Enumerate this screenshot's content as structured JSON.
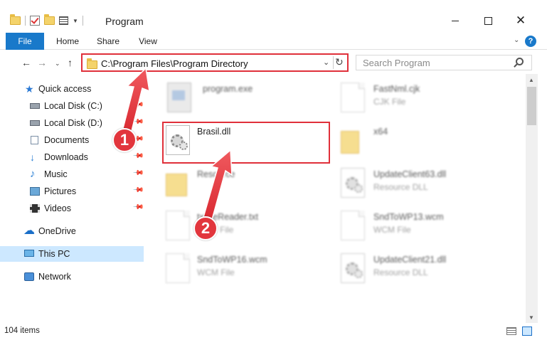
{
  "window": {
    "title": "Program",
    "minimize_icon": "minimize-icon",
    "maximize_icon": "maximize-icon",
    "close_glyph": "✕"
  },
  "ribbon": {
    "tabs": [
      "File",
      "Home",
      "Share",
      "View"
    ],
    "expand_glyph": "⌄",
    "help_glyph": "?"
  },
  "nav": {
    "back_glyph": "←",
    "forward_glyph": "→",
    "recent_glyph": "⌄",
    "up_glyph": "↑",
    "address": "C:\\Program Files\\Program Directory",
    "address_drop_glyph": "⌄",
    "refresh_glyph": "↻",
    "search_placeholder": "Search Program"
  },
  "sidebar": {
    "items": [
      {
        "label": "Quick access",
        "icon": "star-icon"
      },
      {
        "label": "Local Disk (C:)",
        "icon": "disk-icon"
      },
      {
        "label": "Local Disk (D:)",
        "icon": "disk-icon"
      },
      {
        "label": "Documents",
        "icon": "documents-icon"
      },
      {
        "label": "Downloads",
        "icon": "download-icon"
      },
      {
        "label": "Music",
        "icon": "music-icon"
      },
      {
        "label": "Pictures",
        "icon": "pictures-icon"
      },
      {
        "label": "Videos",
        "icon": "videos-icon"
      },
      {
        "label": "OneDrive",
        "icon": "cloud-icon"
      },
      {
        "label": "This PC",
        "icon": "computer-icon"
      },
      {
        "label": "Network",
        "icon": "network-icon"
      }
    ],
    "selected": "This PC"
  },
  "files": {
    "program_exe": {
      "name": "program.exe",
      "type": ""
    },
    "fastnml": {
      "name": "FastNml.cjk",
      "type": "CJK File"
    },
    "brasil": {
      "name": "Brasil.dll",
      "type": ""
    },
    "x64": {
      "name": "x64",
      "type": ""
    },
    "resource": {
      "name": "Resource",
      "type": ""
    },
    "updateclient63": {
      "name": "UpdateClient63.dll",
      "type": "Resource DLL"
    },
    "readme": {
      "name": "txtfileReader.txt",
      "type": "File"
    },
    "sndtowp13": {
      "name": "SndToWP13.wcm",
      "type": "WCM File"
    },
    "sndtowp16": {
      "name": "SndToWP16.wcm",
      "type": "WCM File"
    },
    "updateclient21": {
      "name": "UpdateClient21.dll",
      "type": "Resource DLL"
    }
  },
  "scroll": {
    "up_glyph": "▲",
    "down_glyph": "▼"
  },
  "status": {
    "item_count": "104 items"
  },
  "annotations": {
    "step1": "1",
    "step2": "2"
  },
  "colors": {
    "accent": "#1979ca",
    "highlight": "#e0303a",
    "selected": "#cde8ff"
  }
}
